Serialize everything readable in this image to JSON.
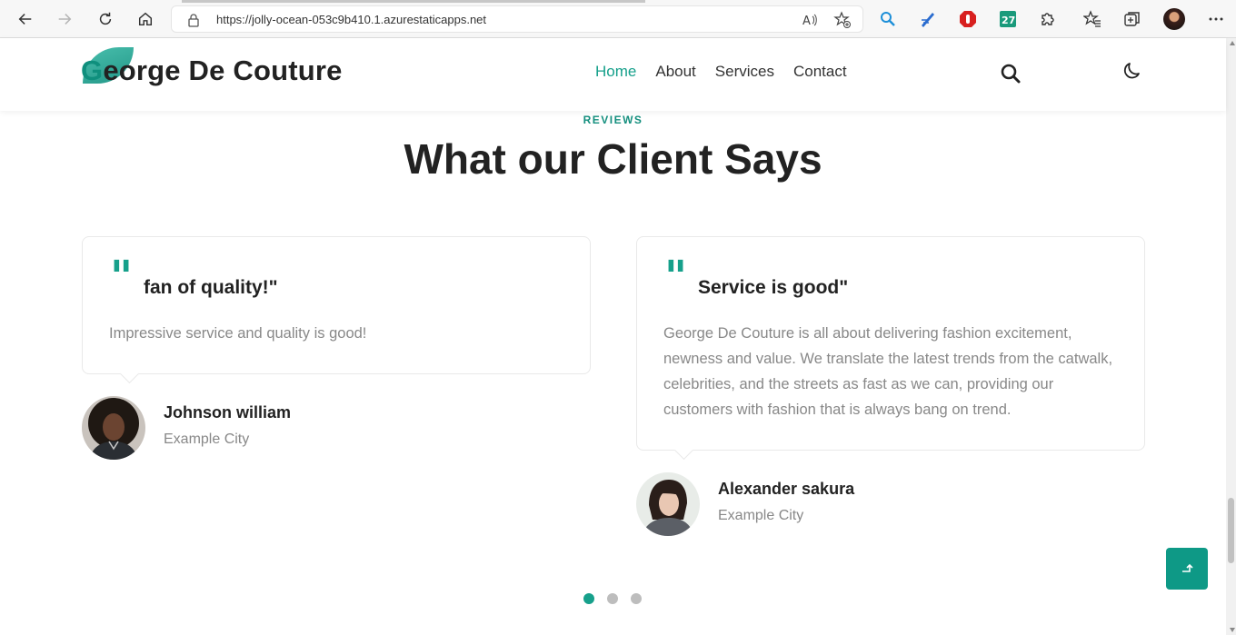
{
  "browser": {
    "url": "https://jolly-ocean-053c9b410.1.azurestaticapps.net"
  },
  "header": {
    "logo_first_letter": "G",
    "logo_rest": "eorge De Couture",
    "nav": [
      {
        "label": "Home",
        "active": true
      },
      {
        "label": "About",
        "active": false
      },
      {
        "label": "Services",
        "active": false
      },
      {
        "label": "Contact",
        "active": false
      }
    ]
  },
  "section": {
    "tag": "REVIEWS",
    "title": "What our Client Says"
  },
  "reviews": [
    {
      "quote_mark": "\"",
      "title": "fan of quality!\"",
      "body": "Impressive service and quality is good!",
      "name": "Johnson william",
      "city": "Example City"
    },
    {
      "quote_mark": "\"",
      "title": "Service is good\"",
      "body": "George De Couture is all about delivering fashion excitement, newness and value. We translate the latest trends from the catwalk, celebrities, and the streets as fast as we can, providing our customers with fashion that is always bang on trend.",
      "name": "Alexander sakura",
      "city": "Example City"
    }
  ],
  "carousel": {
    "active_index": 0,
    "count": 3
  },
  "colors": {
    "accent": "#16a08b",
    "text": "#222222",
    "muted": "#888888"
  }
}
